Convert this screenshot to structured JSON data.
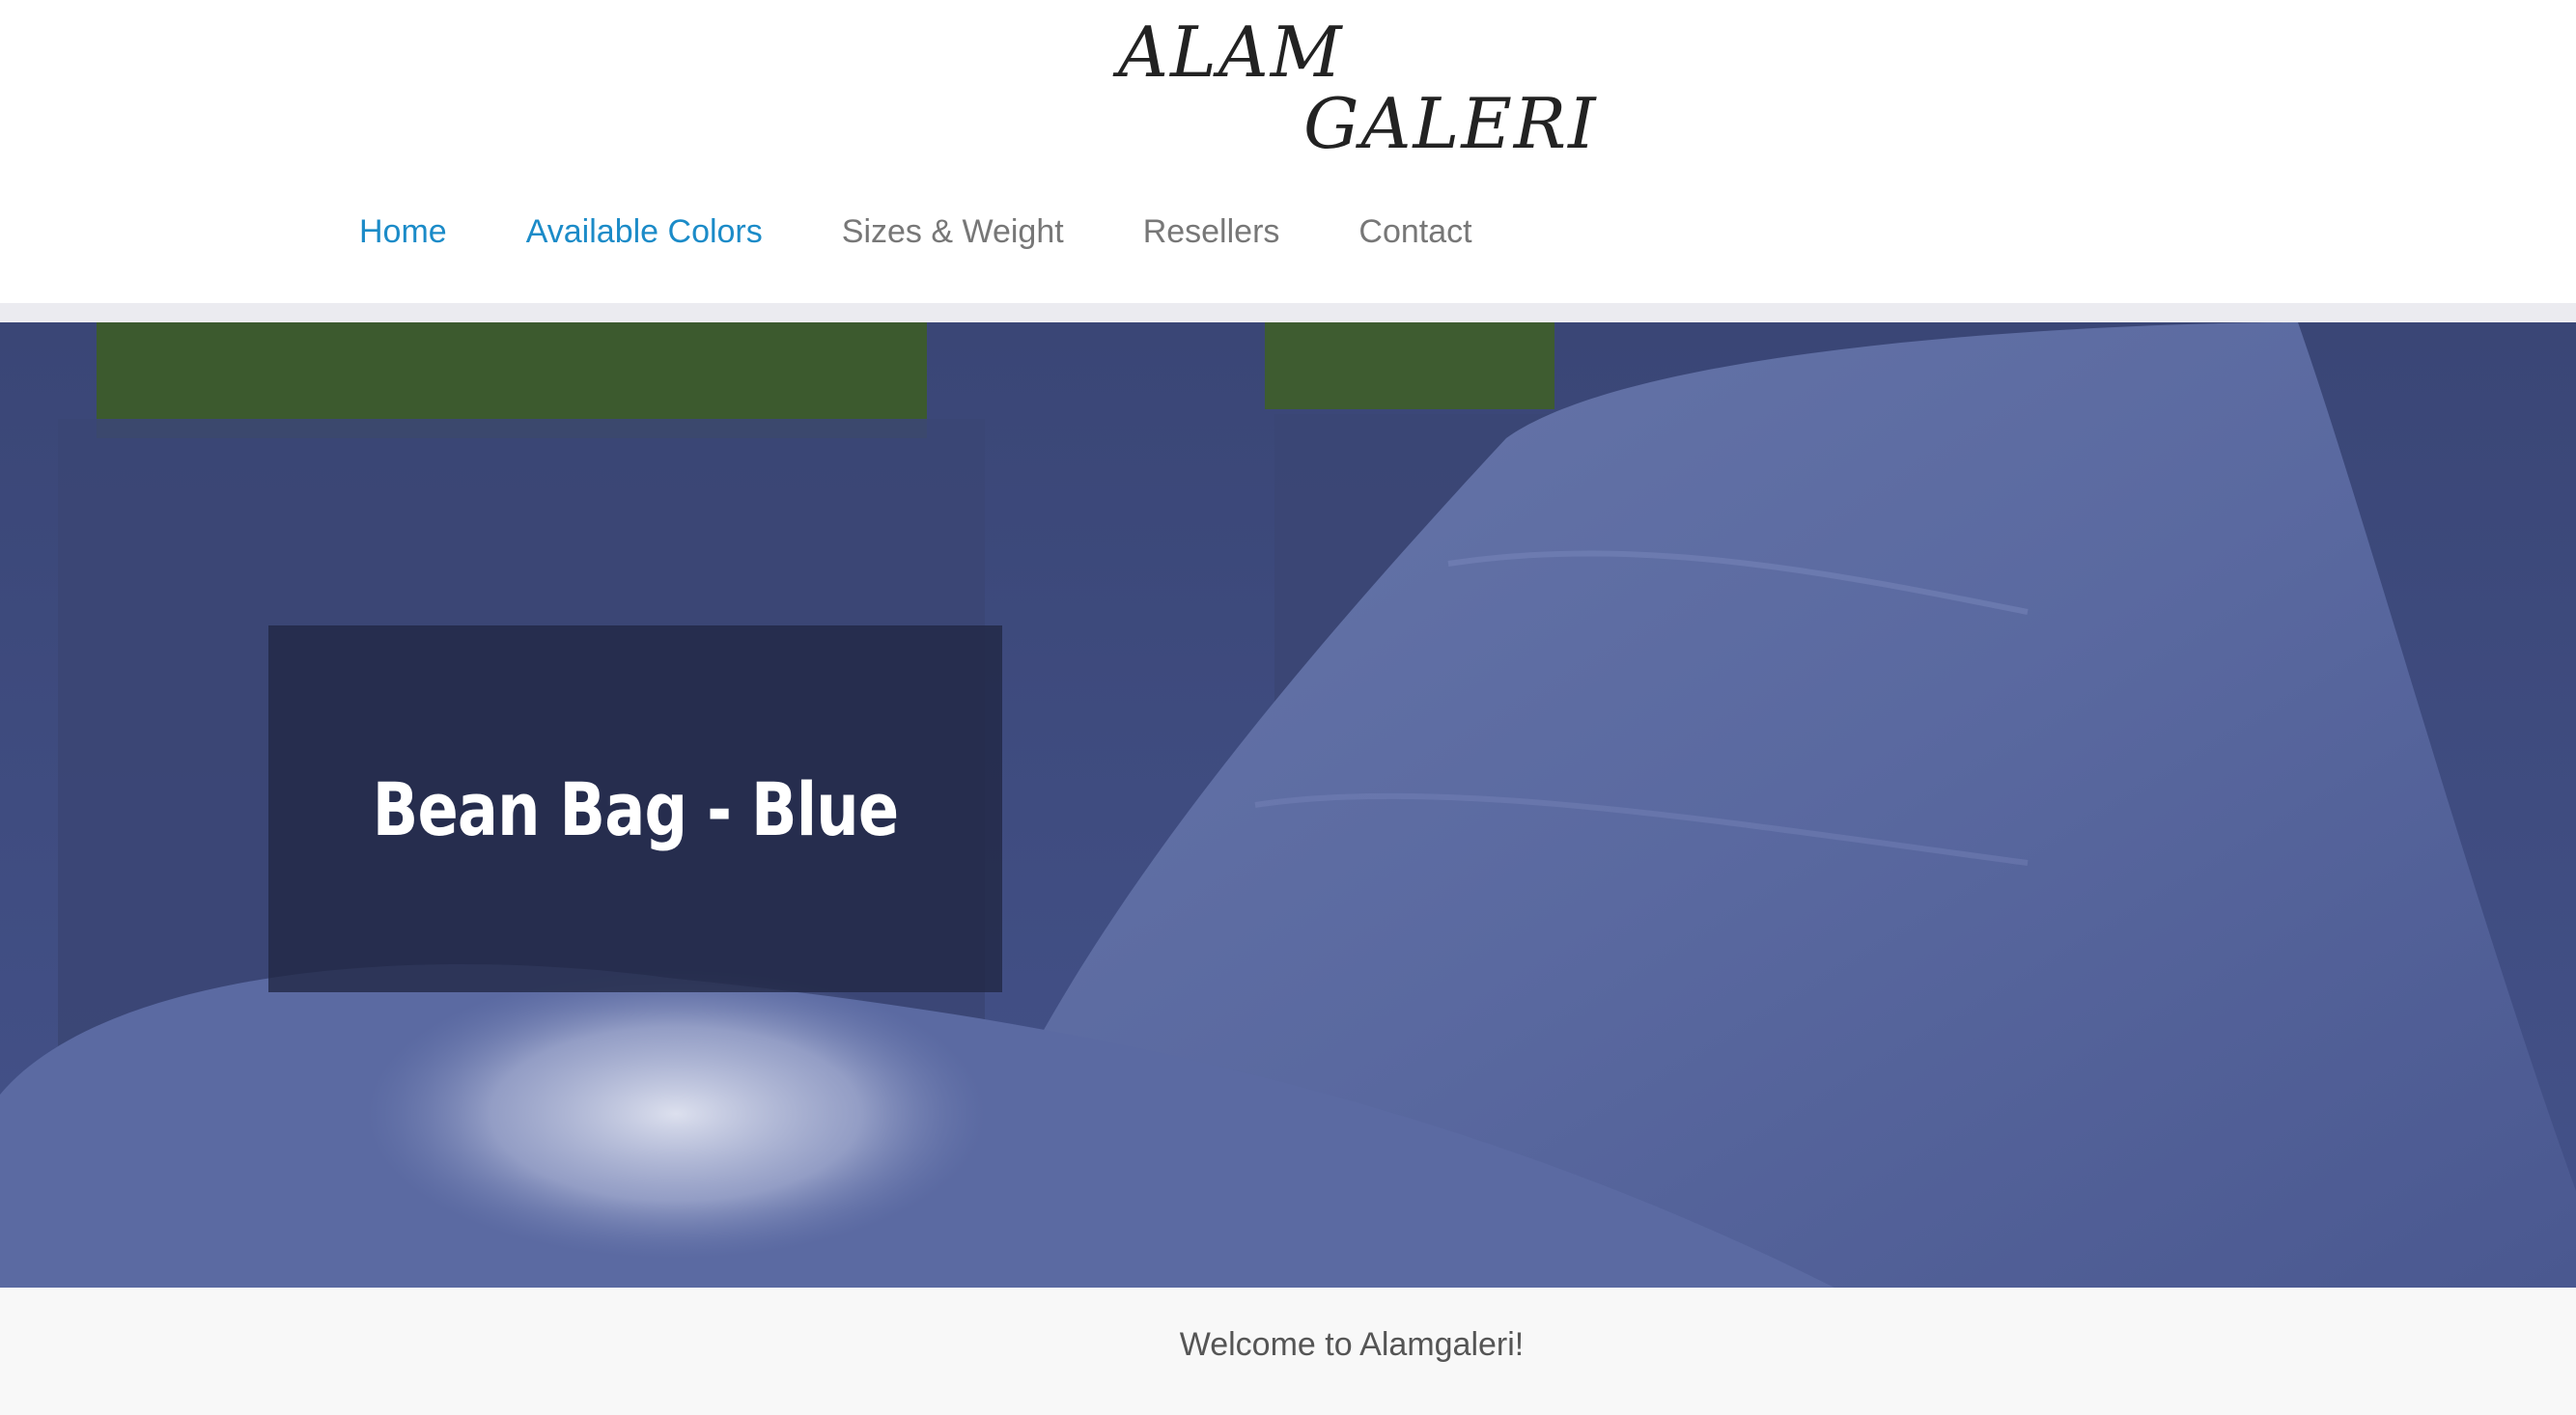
{
  "logo": {
    "line1": "ALAM",
    "line2": "GALERI"
  },
  "nav": {
    "items": [
      {
        "label": "Home",
        "active": true
      },
      {
        "label": "Available Colors",
        "active": true
      },
      {
        "label": "Sizes & Weight",
        "active": false
      },
      {
        "label": "Resellers",
        "active": false
      },
      {
        "label": "Contact",
        "active": false
      }
    ]
  },
  "hero": {
    "caption": "Bean Bag - Blue"
  },
  "welcome": {
    "text": "Welcome to Alamgaleri!"
  },
  "colors": {
    "link_active": "#1b8bc8",
    "link_default": "#777777",
    "hero_blue": "#465488"
  }
}
